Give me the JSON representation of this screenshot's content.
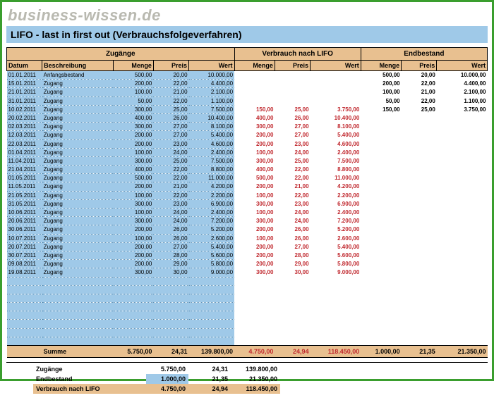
{
  "logo": "business-wissen.de",
  "title": "LIFO - last in first out (Verbrauchsfolgeverfahren)",
  "headers": {
    "group_in": "Zugänge",
    "group_mid": "Verbrauch nach LIFO",
    "group_end": "Endbestand",
    "date": "Datum",
    "desc": "Beschreibung",
    "menge": "Menge",
    "preis": "Preis",
    "wert": "Wert"
  },
  "rows": [
    {
      "d": "01.01.2011",
      "b": "Anfangsbestand",
      "m": "500,00",
      "p": "20,00",
      "w": "10.000,00",
      "vm": "",
      "vp": "",
      "vw": "",
      "em": "500,00",
      "ep": "20,00",
      "ew": "10.000,00"
    },
    {
      "d": "15.01.2011",
      "b": "Zugang",
      "m": "200,00",
      "p": "22,00",
      "w": "4.400,00",
      "vm": "",
      "vp": "",
      "vw": "",
      "em": "200,00",
      "ep": "22,00",
      "ew": "4.400,00"
    },
    {
      "d": "21.01.2011",
      "b": "Zugang",
      "m": "100,00",
      "p": "21,00",
      "w": "2.100,00",
      "vm": "",
      "vp": "",
      "vw": "",
      "em": "100,00",
      "ep": "21,00",
      "ew": "2.100,00"
    },
    {
      "d": "31.01.2011",
      "b": "Zugang",
      "m": "50,00",
      "p": "22,00",
      "w": "1.100,00",
      "vm": "",
      "vp": "",
      "vw": "",
      "em": "50,00",
      "ep": "22,00",
      "ew": "1.100,00"
    },
    {
      "d": "10.02.2011",
      "b": "Zugang",
      "m": "300,00",
      "p": "25,00",
      "w": "7.500,00",
      "vm": "150,00",
      "vp": "25,00",
      "vw": "3.750,00",
      "em": "150,00",
      "ep": "25,00",
      "ew": "3.750,00"
    },
    {
      "d": "20.02.2011",
      "b": "Zugang",
      "m": "400,00",
      "p": "26,00",
      "w": "10.400,00",
      "vm": "400,00",
      "vp": "26,00",
      "vw": "10.400,00",
      "em": "",
      "ep": "",
      "ew": ""
    },
    {
      "d": "02.03.2011",
      "b": "Zugang",
      "m": "300,00",
      "p": "27,00",
      "w": "8.100,00",
      "vm": "300,00",
      "vp": "27,00",
      "vw": "8.100,00",
      "em": "",
      "ep": "",
      "ew": ""
    },
    {
      "d": "12.03.2011",
      "b": "Zugang",
      "m": "200,00",
      "p": "27,00",
      "w": "5.400,00",
      "vm": "200,00",
      "vp": "27,00",
      "vw": "5.400,00",
      "em": "",
      "ep": "",
      "ew": ""
    },
    {
      "d": "22.03.2011",
      "b": "Zugang",
      "m": "200,00",
      "p": "23,00",
      "w": "4.600,00",
      "vm": "200,00",
      "vp": "23,00",
      "vw": "4.600,00",
      "em": "",
      "ep": "",
      "ew": ""
    },
    {
      "d": "01.04.2011",
      "b": "Zugang",
      "m": "100,00",
      "p": "24,00",
      "w": "2.400,00",
      "vm": "100,00",
      "vp": "24,00",
      "vw": "2.400,00",
      "em": "",
      "ep": "",
      "ew": ""
    },
    {
      "d": "11.04.2011",
      "b": "Zugang",
      "m": "300,00",
      "p": "25,00",
      "w": "7.500,00",
      "vm": "300,00",
      "vp": "25,00",
      "vw": "7.500,00",
      "em": "",
      "ep": "",
      "ew": ""
    },
    {
      "d": "21.04.2011",
      "b": "Zugang",
      "m": "400,00",
      "p": "22,00",
      "w": "8.800,00",
      "vm": "400,00",
      "vp": "22,00",
      "vw": "8.800,00",
      "em": "",
      "ep": "",
      "ew": ""
    },
    {
      "d": "01.05.2011",
      "b": "Zugang",
      "m": "500,00",
      "p": "22,00",
      "w": "11.000,00",
      "vm": "500,00",
      "vp": "22,00",
      "vw": "11.000,00",
      "em": "",
      "ep": "",
      "ew": ""
    },
    {
      "d": "11.05.2011",
      "b": "Zugang",
      "m": "200,00",
      "p": "21,00",
      "w": "4.200,00",
      "vm": "200,00",
      "vp": "21,00",
      "vw": "4.200,00",
      "em": "",
      "ep": "",
      "ew": ""
    },
    {
      "d": "21.05.2011",
      "b": "Zugang",
      "m": "100,00",
      "p": "22,00",
      "w": "2.200,00",
      "vm": "100,00",
      "vp": "22,00",
      "vw": "2.200,00",
      "em": "",
      "ep": "",
      "ew": ""
    },
    {
      "d": "31.05.2011",
      "b": "Zugang",
      "m": "300,00",
      "p": "23,00",
      "w": "6.900,00",
      "vm": "300,00",
      "vp": "23,00",
      "vw": "6.900,00",
      "em": "",
      "ep": "",
      "ew": ""
    },
    {
      "d": "10.06.2011",
      "b": "Zugang",
      "m": "100,00",
      "p": "24,00",
      "w": "2.400,00",
      "vm": "100,00",
      "vp": "24,00",
      "vw": "2.400,00",
      "em": "",
      "ep": "",
      "ew": ""
    },
    {
      "d": "20.06.2011",
      "b": "Zugang",
      "m": "300,00",
      "p": "24,00",
      "w": "7.200,00",
      "vm": "300,00",
      "vp": "24,00",
      "vw": "7.200,00",
      "em": "",
      "ep": "",
      "ew": ""
    },
    {
      "d": "30.06.2011",
      "b": "Zugang",
      "m": "200,00",
      "p": "26,00",
      "w": "5.200,00",
      "vm": "200,00",
      "vp": "26,00",
      "vw": "5.200,00",
      "em": "",
      "ep": "",
      "ew": ""
    },
    {
      "d": "10.07.2011",
      "b": "Zugang",
      "m": "100,00",
      "p": "26,00",
      "w": "2.600,00",
      "vm": "100,00",
      "vp": "26,00",
      "vw": "2.600,00",
      "em": "",
      "ep": "",
      "ew": ""
    },
    {
      "d": "20.07.2011",
      "b": "Zugang",
      "m": "200,00",
      "p": "27,00",
      "w": "5.400,00",
      "vm": "200,00",
      "vp": "27,00",
      "vw": "5.400,00",
      "em": "",
      "ep": "",
      "ew": ""
    },
    {
      "d": "30.07.2011",
      "b": "Zugang",
      "m": "200,00",
      "p": "28,00",
      "w": "5.600,00",
      "vm": "200,00",
      "vp": "28,00",
      "vw": "5.600,00",
      "em": "",
      "ep": "",
      "ew": ""
    },
    {
      "d": "09.08.2011",
      "b": "Zugang",
      "m": "200,00",
      "p": "29,00",
      "w": "5.800,00",
      "vm": "200,00",
      "vp": "29,00",
      "vw": "5.800,00",
      "em": "",
      "ep": "",
      "ew": ""
    },
    {
      "d": "19.08.2011",
      "b": "Zugang",
      "m": "300,00",
      "p": "30,00",
      "w": "9.000,00",
      "vm": "300,00",
      "vp": "30,00",
      "vw": "9.000,00",
      "em": "",
      "ep": "",
      "ew": ""
    }
  ],
  "sum": {
    "label": "Summe",
    "m": "5.750,00",
    "p": "24,31",
    "w": "139.800,00",
    "vm": "4.750,00",
    "vp": "24,94",
    "vw": "118.450,00",
    "em": "1.000,00",
    "ep": "21,35",
    "ew": "21.350,00"
  },
  "bottom": {
    "r1": {
      "label": "Zugänge",
      "m": "5.750,00",
      "p": "24,31",
      "w": "139.800,00"
    },
    "r2": {
      "label": "Endbestand",
      "m": "1.000,00",
      "p": "21,35",
      "w": "21.350,00"
    },
    "r3": {
      "label": "Verbrauch nach LIFO",
      "m": "4.750,00",
      "p": "24,94",
      "w": "118.450,00"
    }
  }
}
